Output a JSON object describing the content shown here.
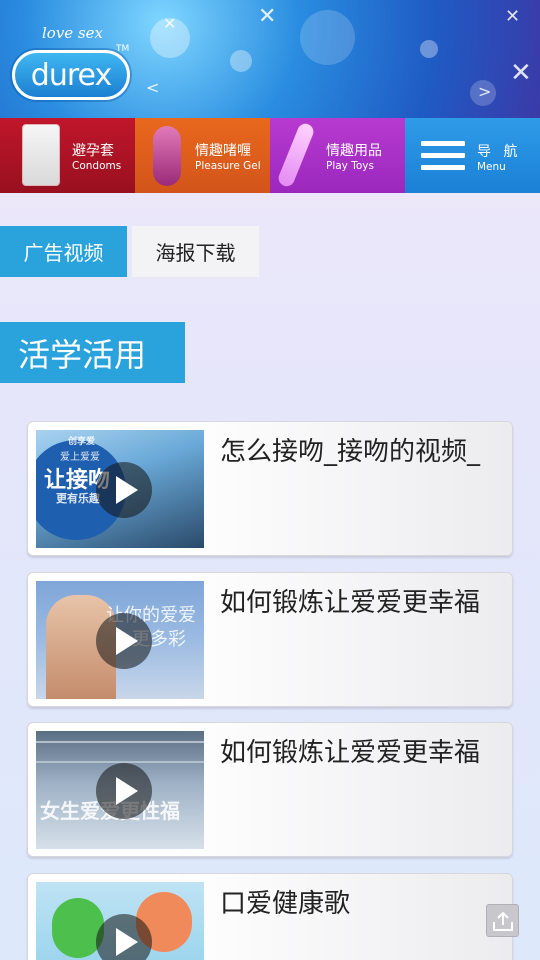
{
  "header": {
    "tagline": "love sex",
    "brand": "durex",
    "trademark": "TM"
  },
  "categories": [
    {
      "zh": "避孕套",
      "en": "Condoms"
    },
    {
      "zh": "情趣啫喱",
      "en": "Pleasure Gel"
    },
    {
      "zh": "情趣用品",
      "en": "Play Toys"
    },
    {
      "zh": "导 航",
      "en": "Menu"
    }
  ],
  "tabs": [
    {
      "label": "广告视频",
      "active": true
    },
    {
      "label": "海报下载",
      "active": false
    }
  ],
  "section": {
    "title": "活学活用"
  },
  "videos": [
    {
      "title": "怎么接吻_接吻的视频_",
      "thumb_text_1": "创享爱",
      "thumb_text_2": "爱上爱爱",
      "thumb_text_3": "让接吻",
      "thumb_text_4": "更有乐趣"
    },
    {
      "title": "如何锻炼让爱爱更幸福",
      "thumb_text_1": "让你的爱爱",
      "thumb_text_2": "更多彩"
    },
    {
      "title": "如何锻炼让爱爱更幸福",
      "thumb_text_1": "女生爱爱更性福"
    },
    {
      "title": "口爱健康歌"
    }
  ],
  "colors": {
    "accent": "#2aa3dc",
    "condoms": "#c0162b",
    "gel": "#e8681e",
    "toys": "#b73ad0",
    "menu": "#2f9ce8"
  },
  "icons": {
    "play": "play-icon",
    "menu": "hamburger-icon",
    "scroll_top": "scroll-top-icon"
  }
}
